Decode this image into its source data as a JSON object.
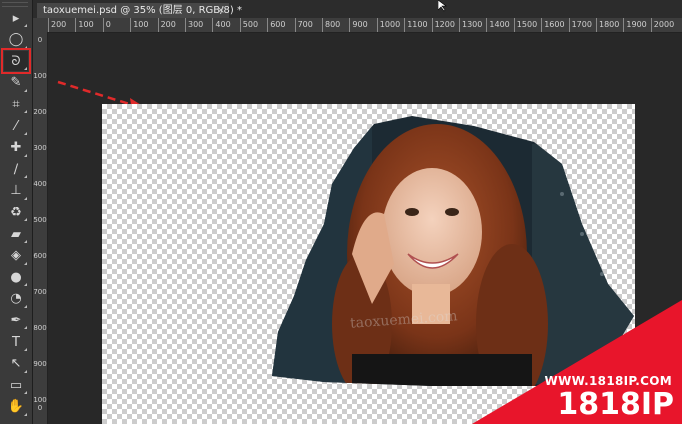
{
  "document_tab": {
    "title": "taoxuemei.psd @ 35% (图层 0, RGB/8) *",
    "close_symbol": "×"
  },
  "ruler": {
    "horizontal_labels": [
      "200",
      "100",
      "0",
      "100",
      "200",
      "300",
      "400",
      "500",
      "600",
      "700",
      "800",
      "900",
      "1000",
      "1100",
      "1200",
      "1300",
      "1400",
      "1500",
      "1600",
      "1700",
      "1800",
      "1900",
      "2000"
    ],
    "vertical_labels": [
      "0",
      "100",
      "200",
      "300",
      "400",
      "500",
      "600",
      "700",
      "800",
      "900",
      "1000"
    ]
  },
  "tools": [
    {
      "name": "move-tool-icon",
      "glyph": "▸"
    },
    {
      "name": "elliptical-marquee-tool-icon",
      "glyph": "◯"
    },
    {
      "name": "lasso-tool-icon",
      "glyph": "ᘐ",
      "active": true
    },
    {
      "name": "quick-selection-tool-icon",
      "glyph": "✎"
    },
    {
      "name": "crop-tool-icon",
      "glyph": "⌗"
    },
    {
      "name": "eyedropper-tool-icon",
      "glyph": "⁄"
    },
    {
      "name": "healing-brush-tool-icon",
      "glyph": "✚"
    },
    {
      "name": "brush-tool-icon",
      "glyph": "∕"
    },
    {
      "name": "clone-stamp-tool-icon",
      "glyph": "⊥"
    },
    {
      "name": "history-brush-tool-icon",
      "glyph": "♻"
    },
    {
      "name": "eraser-tool-icon",
      "glyph": "▰"
    },
    {
      "name": "paint-bucket-tool-icon",
      "glyph": "◈"
    },
    {
      "name": "blur-tool-icon",
      "glyph": "●"
    },
    {
      "name": "dodge-tool-icon",
      "glyph": "◔"
    },
    {
      "name": "pen-tool-icon",
      "glyph": "✒"
    },
    {
      "name": "type-tool-icon",
      "glyph": "T"
    },
    {
      "name": "path-selection-tool-icon",
      "glyph": "↖"
    },
    {
      "name": "rectangle-tool-icon",
      "glyph": "▭"
    },
    {
      "name": "hand-tool-icon",
      "glyph": "✋"
    }
  ],
  "watermark": {
    "text": "taoxuemei.com"
  },
  "badge": {
    "url": "WWW.1818IP.COM",
    "brand": "1818IP",
    "color": "#e8152b"
  },
  "accent": {
    "highlight_color": "#e02a2a"
  }
}
